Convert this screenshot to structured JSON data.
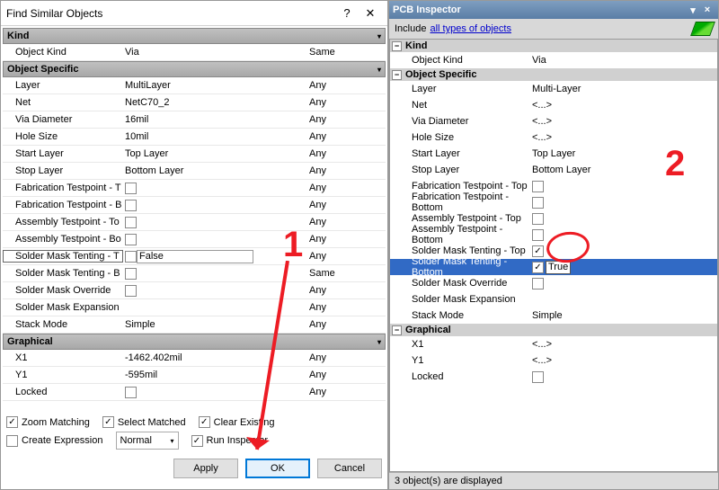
{
  "left": {
    "title": "Find Similar Objects",
    "sections": {
      "kind": "Kind",
      "objspec": "Object Specific",
      "graphical": "Graphical"
    },
    "rows": {
      "objKind": {
        "label": "Object Kind",
        "value": "Via",
        "match": "Same"
      },
      "layer": {
        "label": "Layer",
        "value": "MultiLayer",
        "match": "Any"
      },
      "net": {
        "label": "Net",
        "value": "NetC70_2",
        "match": "Any"
      },
      "viaDia": {
        "label": "Via Diameter",
        "value": "16mil",
        "match": "Any"
      },
      "holeSize": {
        "label": "Hole Size",
        "value": "10mil",
        "match": "Any"
      },
      "startLayer": {
        "label": "Start Layer",
        "value": "Top Layer",
        "match": "Any"
      },
      "stopLayer": {
        "label": "Stop Layer",
        "value": "Bottom Layer",
        "match": "Any"
      },
      "fabT": {
        "label": "Fabrication Testpoint - T",
        "match": "Any"
      },
      "fabB": {
        "label": "Fabrication Testpoint - B",
        "match": "Any"
      },
      "asmT": {
        "label": "Assembly Testpoint - To",
        "match": "Any"
      },
      "asmB": {
        "label": "Assembly Testpoint - Bo",
        "match": "Any"
      },
      "smtT": {
        "label": "Solder Mask Tenting - T",
        "value": "False",
        "match": "Any"
      },
      "smtB": {
        "label": "Solder Mask Tenting - B",
        "match": "Same"
      },
      "smo": {
        "label": "Solder Mask Override",
        "match": "Any"
      },
      "sme": {
        "label": "Solder Mask Expansion",
        "match": "Any"
      },
      "stack": {
        "label": "Stack Mode",
        "value": "Simple",
        "match": "Any"
      },
      "x1": {
        "label": "X1",
        "value": "-1462.402mil",
        "match": "Any"
      },
      "y1": {
        "label": "Y1",
        "value": "-595mil",
        "match": "Any"
      },
      "locked": {
        "label": "Locked",
        "match": "Any"
      }
    },
    "opts": {
      "zoom": "Zoom Matching",
      "selmatch": "Select Matched",
      "clear": "Clear Existing",
      "createExpr": "Create Expression",
      "runInsp": "Run Inspector",
      "normal": "Normal"
    },
    "buttons": {
      "apply": "Apply",
      "ok": "OK",
      "cancel": "Cancel"
    }
  },
  "right": {
    "title": "PCB Inspector",
    "includeLabel": "Include",
    "includeLink": "all types of objects",
    "sections": {
      "kind": "Kind",
      "objspec": "Object Specific",
      "graphical": "Graphical"
    },
    "rows": {
      "objKind": {
        "label": "Object Kind",
        "value": "Via"
      },
      "layer": {
        "label": "Layer",
        "value": "Multi-Layer"
      },
      "net": {
        "label": "Net",
        "value": "<...>"
      },
      "viaDia": {
        "label": "Via Diameter",
        "value": "<...>"
      },
      "holeSize": {
        "label": "Hole Size",
        "value": "<...>"
      },
      "startLayer": {
        "label": "Start Layer",
        "value": "Top Layer"
      },
      "stopLayer": {
        "label": "Stop Layer",
        "value": "Bottom Layer"
      },
      "fabT": {
        "label": "Fabrication Testpoint - Top"
      },
      "fabB": {
        "label": "Fabrication Testpoint - Bottom"
      },
      "asmT": {
        "label": "Assembly Testpoint - Top"
      },
      "asmB": {
        "label": "Assembly Testpoint - Bottom"
      },
      "smtT": {
        "label": "Solder Mask Tenting - Top"
      },
      "smtB": {
        "label": "Solder Mask Tenting - Bottom",
        "value": "True"
      },
      "smo": {
        "label": "Solder Mask Override"
      },
      "sme": {
        "label": "Solder Mask Expansion"
      },
      "stack": {
        "label": "Stack Mode",
        "value": "Simple"
      },
      "x1": {
        "label": "X1",
        "value": "<...>"
      },
      "y1": {
        "label": "Y1",
        "value": "<...>"
      },
      "locked": {
        "label": "Locked"
      }
    },
    "status": "3 object(s) are displayed"
  },
  "anno": {
    "one": "1",
    "two": "2"
  }
}
